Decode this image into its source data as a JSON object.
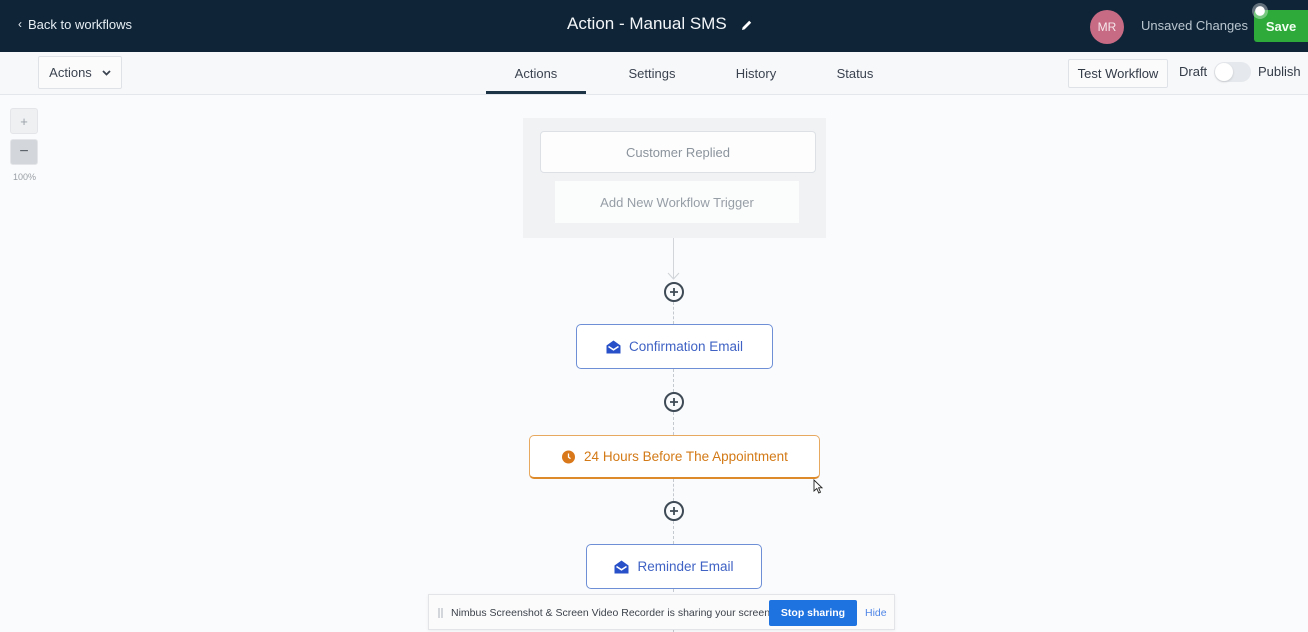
{
  "header": {
    "back_label": "Back to workflows",
    "title": "Action - Manual SMS",
    "edit_icon": "pencil-icon",
    "avatar_initials": "MR",
    "status_text": "Unsaved Changes",
    "save_label": "Save",
    "colors": {
      "background": "#0f2537",
      "save": "#2eaa3a",
      "avatar": "#c76a84"
    }
  },
  "toolbar": {
    "actions_dropdown": "Actions",
    "tabs": [
      {
        "label": "Actions",
        "active": true
      },
      {
        "label": "Settings",
        "active": false
      },
      {
        "label": "History",
        "active": false
      },
      {
        "label": "Status",
        "active": false
      }
    ],
    "test_workflow_label": "Test Workflow",
    "draft_label": "Draft",
    "publish_label": "Publish",
    "published": false
  },
  "zoom": {
    "zoom_in_label": "+",
    "zoom_out_label": "−",
    "level": "100%"
  },
  "workflow": {
    "trigger": "Customer Replied",
    "add_trigger_label": "Add New Workflow Trigger",
    "steps": [
      {
        "type": "email",
        "icon": "envelope-open-icon",
        "label": "Confirmation Email",
        "color": "#3f62c4"
      },
      {
        "type": "wait",
        "icon": "clock-icon",
        "label": "24 Hours Before The Appointment",
        "color": "#d37a17"
      },
      {
        "type": "email",
        "icon": "envelope-open-icon",
        "label": "Reminder Email",
        "color": "#3f62c4"
      }
    ]
  },
  "screen_share": {
    "message": "Nimbus Screenshot & Screen Video Recorder is sharing your screen.",
    "stop_label": "Stop sharing",
    "hide_label": "Hide"
  }
}
